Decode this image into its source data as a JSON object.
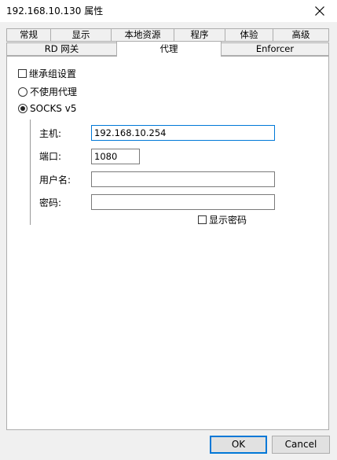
{
  "window": {
    "title": "192.168.10.130 属性",
    "close_label": "close"
  },
  "tabs": {
    "row1": [
      "常规",
      "显示",
      "本地资源",
      "程序",
      "体验",
      "高级"
    ],
    "row2": [
      "RD 网关",
      "代理",
      "Enforcer"
    ],
    "active": "代理"
  },
  "proxy": {
    "inherit_label": "继承组设置",
    "inherit_checked": false,
    "no_proxy_label": "不使用代理",
    "socks_label": "SOCKS v5",
    "selected": "SOCKS v5",
    "host_label": "主机:",
    "host_value": "192.168.10.254",
    "port_label": "端口:",
    "port_value": "1080",
    "user_label": "用户名:",
    "user_value": "",
    "password_label": "密码:",
    "password_value": "",
    "show_password_label": "显示密码",
    "show_password_checked": false
  },
  "buttons": {
    "ok": "OK",
    "cancel": "Cancel"
  },
  "colors": {
    "focus_border": "#0078d7",
    "panel_bg": "#ffffff",
    "window_bg": "#f0f0f0"
  }
}
